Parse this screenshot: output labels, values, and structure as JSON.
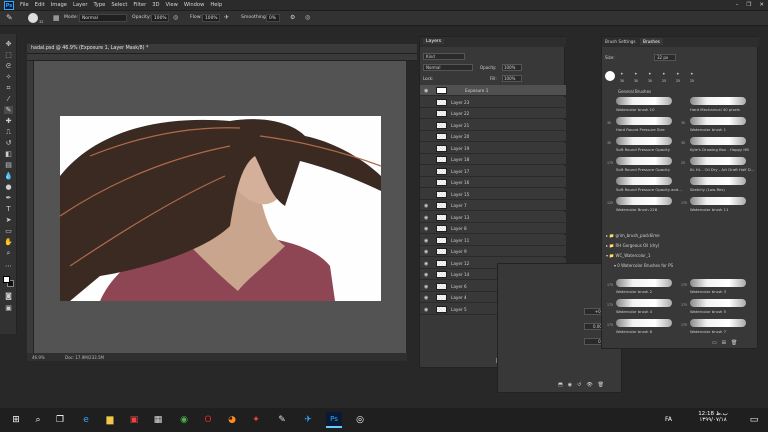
{
  "menubar": {
    "logo": "Ps",
    "items": [
      "File",
      "Edit",
      "Image",
      "Layer",
      "Type",
      "Select",
      "Filter",
      "3D",
      "View",
      "Window",
      "Help"
    ],
    "controls": [
      "–",
      "❐",
      "✕"
    ]
  },
  "options": {
    "mode_label": "Mode:",
    "mode_value": "Normal",
    "opacity_label": "Opacity:",
    "opacity_value": "100%",
    "flow_label": "Flow:",
    "flow_value": "100%",
    "smoothing_label": "Smoothing:",
    "smoothing_value": "0%",
    "brush_size": "32"
  },
  "document": {
    "tab_title": "hadal.psd @ 46.9% (Exposure 1, Layer Mask/8) *",
    "zoom": "46.9%",
    "doc_info": "Doc: 17.9M/233.5M"
  },
  "layers": {
    "title": "Layers",
    "kind_label": "Kind",
    "blend": "Normal",
    "opacity_label": "Opacity:",
    "opacity_value": "100%",
    "lock_label": "Lock:",
    "fill_label": "Fill:",
    "fill_value": "100%",
    "rows": [
      {
        "name": "Exposure 1",
        "visible": true
      },
      {
        "name": "Layer 23",
        "visible": false
      },
      {
        "name": "Layer 22",
        "visible": false
      },
      {
        "name": "Layer 21",
        "visible": false
      },
      {
        "name": "Layer 20",
        "visible": false
      },
      {
        "name": "Layer 19",
        "visible": false
      },
      {
        "name": "Layer 18",
        "visible": false
      },
      {
        "name": "Layer 17",
        "visible": false
      },
      {
        "name": "Layer 16",
        "visible": false
      },
      {
        "name": "Layer 15",
        "visible": false
      },
      {
        "name": "Layer 7",
        "visible": true
      },
      {
        "name": "Layer 13",
        "visible": true
      },
      {
        "name": "Layer 8",
        "visible": true
      },
      {
        "name": "Layer 11",
        "visible": true
      },
      {
        "name": "Layer 9",
        "visible": true
      },
      {
        "name": "Layer 12",
        "visible": true
      },
      {
        "name": "Layer 14",
        "visible": true
      },
      {
        "name": "Layer 6",
        "visible": true
      },
      {
        "name": "Layer 4",
        "visible": true
      },
      {
        "name": "Layer 5",
        "visible": true
      }
    ]
  },
  "brushes": {
    "tab1": "Brush Settings",
    "tab2": "Brushes",
    "size_label": "Size:",
    "size_value": "32 px",
    "preset_sizes": [
      "30",
      "30",
      "30",
      "25",
      "25",
      "25"
    ],
    "group_general": "General Brushes",
    "cells": [
      {
        "label": "Watercolor brush 10",
        "num": ""
      },
      {
        "label": "Hard Mechanical 40 pixels",
        "num": ""
      },
      {
        "label": "Hard Round Pressure Size",
        "num": "30"
      },
      {
        "label": "Watercolor brush 1",
        "num": "30"
      },
      {
        "label": "Soft Round Pressure Opacity",
        "num": "30"
      },
      {
        "label": "Kyle's Drawing Box - Happy HB",
        "num": "30"
      },
      {
        "label": "Soft Round Pressure Opacity",
        "num": "175"
      },
      {
        "label": "KL HL - Oil Dry - Art Draft Half D...",
        "num": "25"
      },
      {
        "label": "Soft Round Pressure Opacity and...",
        "num": ""
      },
      {
        "label": "Sketchy (Low-Res)",
        "num": ""
      },
      {
        "label": "Watercolor Brush 228",
        "num": "125"
      },
      {
        "label": "Watercolor brush 11",
        "num": "175"
      }
    ],
    "folders": [
      "grim_brush_pack6ime",
      "RH Gorgeous Oil (dry)",
      "WC_Watercolor_1",
      "0 Watercolor Brushes for PS"
    ],
    "cells2": [
      {
        "label": "Watercolor brush 2",
        "num": "175"
      },
      {
        "label": "Watercolor brush 3",
        "num": "175"
      },
      {
        "label": "Watercolor brush 4",
        "num": "175"
      },
      {
        "label": "Watercolor brush 5",
        "num": "175"
      },
      {
        "label": "Watercolor brush 6",
        "num": "175"
      },
      {
        "label": "Watercolor brush 7",
        "num": "175"
      }
    ]
  },
  "props": {
    "v1": "+0.00",
    "v2": "0.0000",
    "v3": "0.90"
  },
  "taskbar": {
    "time": "12:18 ب.ظ",
    "date": "۱۳۹۹/۰۷/۱۸",
    "lang": "FA"
  }
}
